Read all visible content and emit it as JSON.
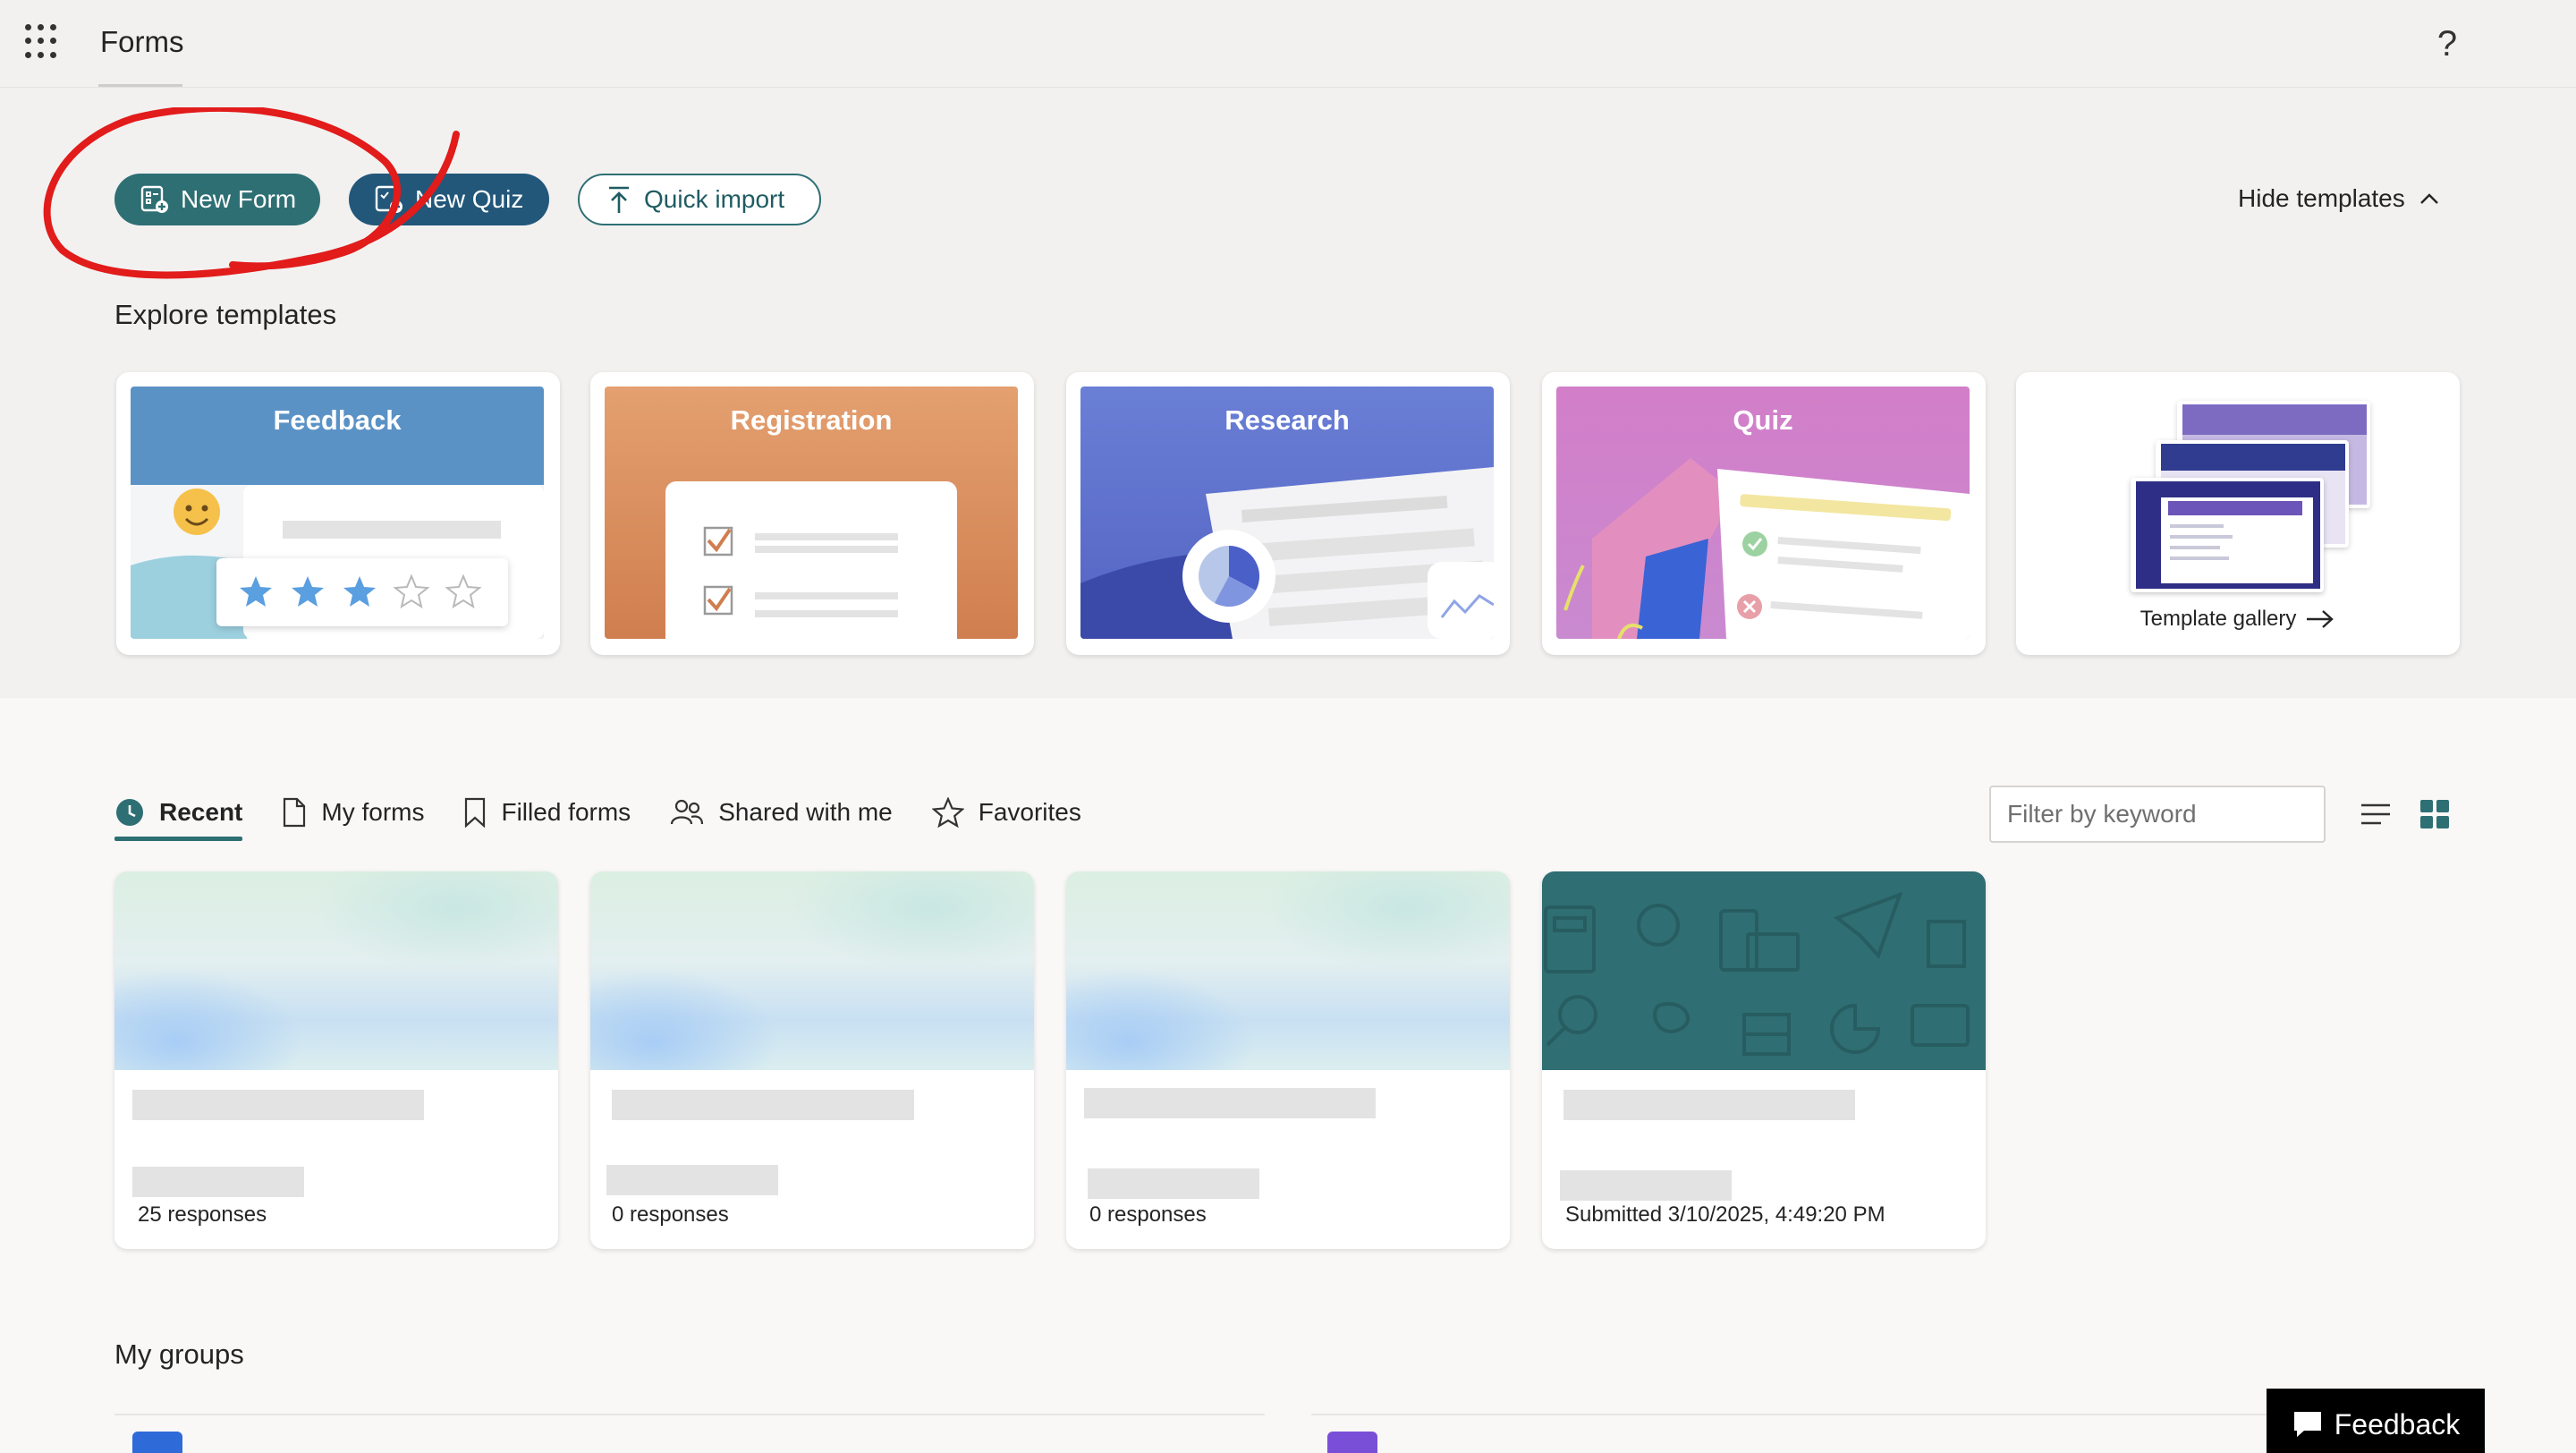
{
  "header": {
    "app_title": "Forms",
    "help_label": "?"
  },
  "actions": {
    "new_form": "New Form",
    "new_quiz": "New Quiz",
    "quick_import": "Quick import",
    "hide_templates": "Hide templates"
  },
  "templates": {
    "heading": "Explore templates",
    "cards": [
      {
        "title": "Feedback"
      },
      {
        "title": "Registration"
      },
      {
        "title": "Research"
      },
      {
        "title": "Quiz"
      }
    ],
    "gallery_label": "Template gallery"
  },
  "recent": {
    "tabs": [
      {
        "label": "Recent",
        "icon": "clock-icon"
      },
      {
        "label": "My forms",
        "icon": "document-icon"
      },
      {
        "label": "Filled forms",
        "icon": "bookmark-icon"
      },
      {
        "label": "Shared with me",
        "icon": "people-icon"
      },
      {
        "label": "Favorites",
        "icon": "star-icon"
      }
    ],
    "filter_placeholder": "Filter by keyword",
    "forms": [
      {
        "meta": "25 responses"
      },
      {
        "meta": "0 responses"
      },
      {
        "meta": "0 responses"
      },
      {
        "meta": "Submitted 3/10/2025, 4:49:20 PM"
      }
    ]
  },
  "groups": {
    "heading": "My groups"
  },
  "feedback_button": "Feedback",
  "colors": {
    "accent_teal": "#2e6f74",
    "quiz_blue": "#22577a",
    "annotation_red": "#e21b1b"
  }
}
